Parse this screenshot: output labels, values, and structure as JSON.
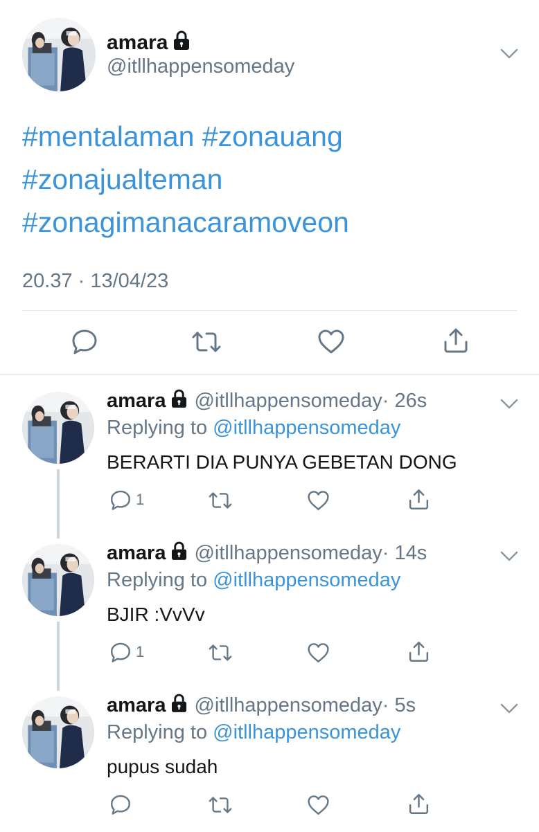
{
  "colors": {
    "link": "#3b94d9",
    "secondary_text": "#657786",
    "primary_text": "#14171a",
    "divider": "#e1e8ed",
    "thread_line": "#ccd6dd"
  },
  "main_tweet": {
    "display_name": "amara",
    "handle": "@itllhappensomeday",
    "hashtags": [
      "#mentalaman",
      "#zonauang",
      "#zonajualteman",
      "#zonagimanacaramoveon"
    ],
    "timestamp": "20.37 · 13/04/23",
    "icons": {
      "lock": "lock-icon",
      "chevron": "chevron-down-icon",
      "reply": "reply-icon",
      "retweet": "retweet-icon",
      "like": "heart-icon",
      "share": "share-icon"
    }
  },
  "replies": [
    {
      "display_name": "amara",
      "handle": "@itllhappensomeday",
      "time": "· 26s",
      "replying_prefix": "Replying to",
      "replying_to": "@itllhappensomeday",
      "text": "BERARTI DIA PUNYA GEBETAN DONG",
      "reply_count": "1"
    },
    {
      "display_name": "amara",
      "handle": "@itllhappensomeday",
      "time": "· 14s",
      "replying_prefix": "Replying to",
      "replying_to": "@itllhappensomeday",
      "text": "BJIR :VvVv",
      "reply_count": "1"
    },
    {
      "display_name": "amara",
      "handle": "@itllhappensomeday",
      "time": "· 5s",
      "replying_prefix": "Replying to",
      "replying_to": "@itllhappensomeday",
      "text": "pupus sudah",
      "reply_count": ""
    }
  ]
}
